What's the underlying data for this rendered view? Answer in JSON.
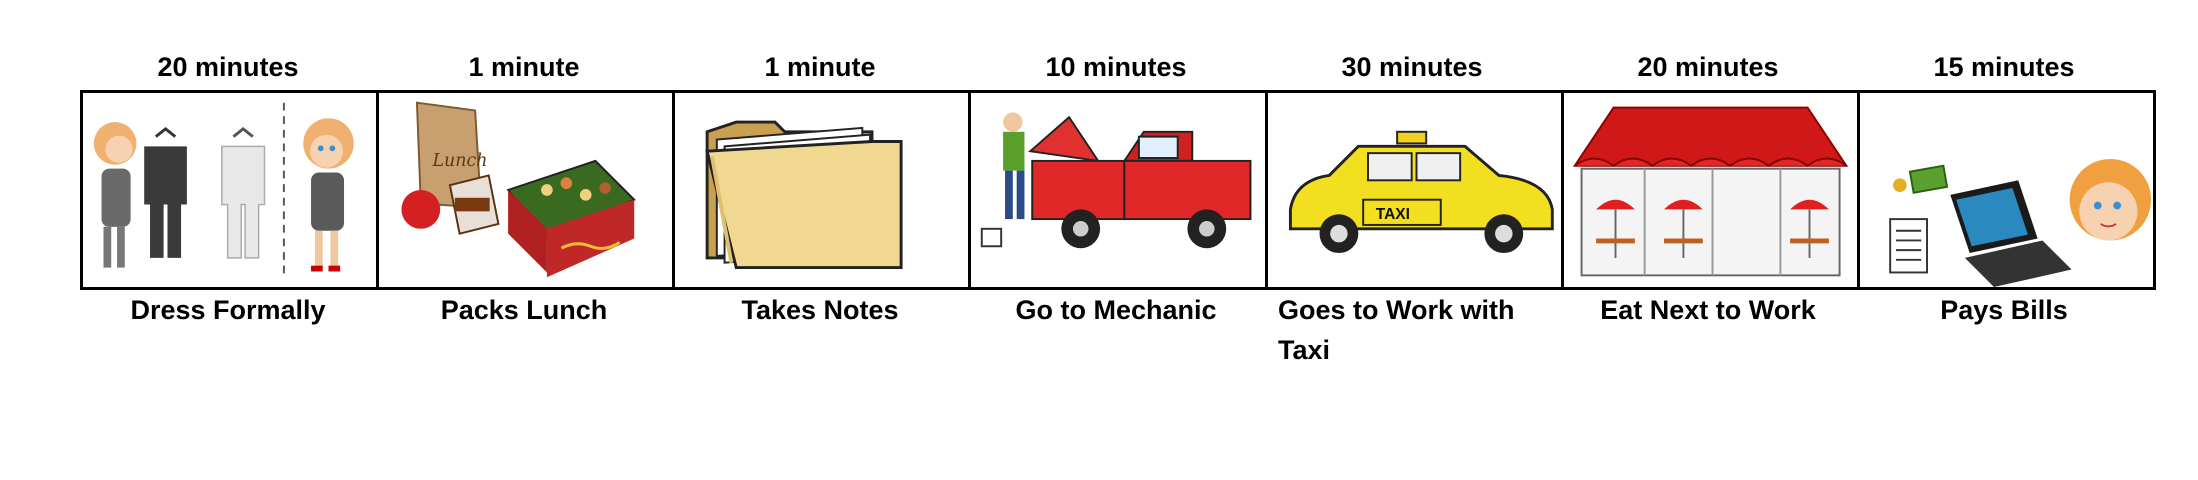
{
  "activities": [
    {
      "duration": "20 minutes",
      "label": "Dress Formally",
      "icon": "dressing-woman-icon"
    },
    {
      "duration": "1 minute",
      "label": "Packs Lunch",
      "icon": "lunch-bag-icon"
    },
    {
      "duration": "1 minute",
      "label": "Takes Notes",
      "icon": "folder-icon"
    },
    {
      "duration": "10 minutes",
      "label": "Go to Mechanic",
      "icon": "mechanic-truck-icon"
    },
    {
      "duration": "30 minutes",
      "label": "Goes to Work with Taxi",
      "icon": "taxi-icon"
    },
    {
      "duration": "20 minutes",
      "label": "Eat Next to Work",
      "icon": "restaurant-icon"
    },
    {
      "duration": "15 minutes",
      "label": "Pays Bills",
      "icon": "laptop-bills-icon"
    }
  ]
}
